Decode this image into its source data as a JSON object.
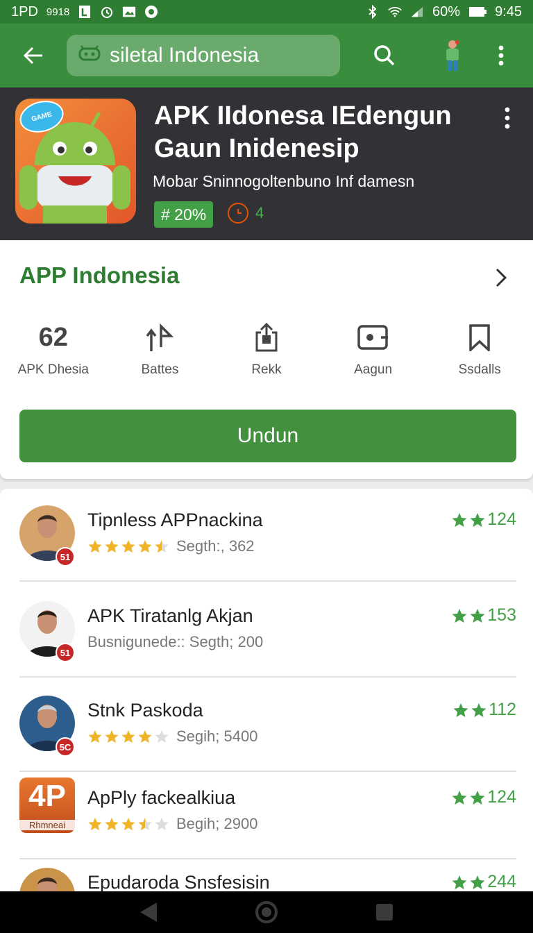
{
  "status_bar": {
    "carrier": "1PD",
    "left_extra": "9918",
    "battery": "60%",
    "time": "9:45",
    "icons": [
      "b-icon",
      "alarm-icon",
      "image-icon",
      "record-icon",
      "bluetooth-icon",
      "wifi-icon",
      "signal-icon",
      "battery-icon"
    ]
  },
  "app_bar": {
    "search_text": "siletal Indonesia",
    "colors": {
      "primary": "#388e3c",
      "status": "#2e7d32"
    }
  },
  "app": {
    "badge_text": "GAME",
    "title": "APK IIdonesa IEdengun Gaun Inidenesip",
    "subtitle": "Mobar Sninnogoltenbuno Inf damesn",
    "rating_badge": "# 20%",
    "review_count": "4"
  },
  "details": {
    "title": "APP Indonesia",
    "actions": [
      {
        "label": "APK Dhesia",
        "icon": "size-icon",
        "icon_text": "62"
      },
      {
        "label": "Battes",
        "icon": "rating-up-icon"
      },
      {
        "label": "Rekk",
        "icon": "share-icon"
      },
      {
        "label": "Aagun",
        "icon": "camera-icon"
      },
      {
        "label": "Ssdalls",
        "icon": "bookmark-icon"
      }
    ],
    "install_label": "Undun"
  },
  "list": [
    {
      "title": "Tipnless APPnackina",
      "meta": "Segth:, 362",
      "stars": 4.5,
      "rating": "124",
      "badge": "51",
      "avatar_type": "person"
    },
    {
      "title": "APK Tiratanlg Akjan",
      "meta": "Busnigunede:: Segth; 200",
      "stars": 0,
      "rating": "153",
      "badge": "51",
      "avatar_type": "person"
    },
    {
      "title": "Stnk Paskoda",
      "meta": "Segih; 5400",
      "stars": 4,
      "rating": "112",
      "badge": "5C",
      "avatar_type": "person"
    },
    {
      "title": "ApPly fackealkiua",
      "meta": "Begih; 2900",
      "stars": 3.5,
      "rating": "124",
      "badge": "",
      "avatar_type": "app",
      "icon_top": "4P",
      "icon_bottom": "Rhmneai"
    },
    {
      "title": "Epudaroda Snsfesisin",
      "meta": "",
      "stars": 0,
      "rating": "244",
      "badge": "",
      "avatar_type": "person"
    }
  ],
  "colors": {
    "accent_green": "#43a047",
    "title_green": "#2e7d32",
    "star_gold": "#f0b429",
    "badge_red": "#c62828"
  }
}
